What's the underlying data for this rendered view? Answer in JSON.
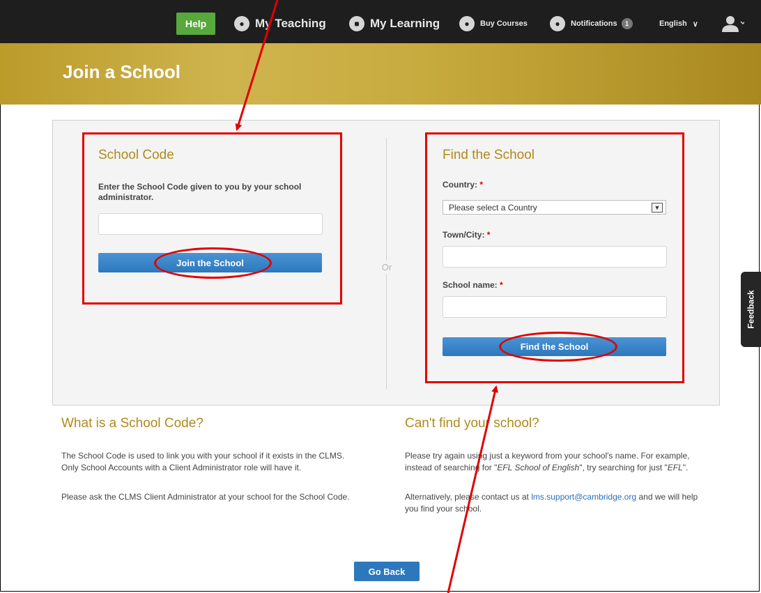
{
  "nav": {
    "help": "Help",
    "my_teaching": "My Teaching",
    "my_learning": "My Learning",
    "buy_courses": "Buy Courses",
    "notifications": "Notifications",
    "notifications_count": "1",
    "language": "English"
  },
  "page_title": "Join a School",
  "school_code": {
    "title": "School Code",
    "instruction": "Enter the School Code given to you by your school administrator.",
    "input_value": "",
    "button": "Join the School"
  },
  "separator": "Or",
  "find_school": {
    "title": "Find the School",
    "country_label": "Country:",
    "country_selected": "Please select a Country",
    "town_label": "Town/City:",
    "school_label": "School name:",
    "required_mark": "*",
    "button": "Find the School"
  },
  "info_left": {
    "heading": "What is a School Code?",
    "p1": "The School Code is used to link you with your school if it exists in the CLMS. Only School Accounts with a Client Administrator role will have it.",
    "p2": "Please ask the CLMS Client Administrator at your school for the School Code."
  },
  "info_right": {
    "heading": "Can't find your school?",
    "p1_a": "Please try again using just a keyword from your school's name. For example, instead of searching for \"",
    "p1_em1": "EFL School of English",
    "p1_b": "\", try searching for just \"",
    "p1_em2": "EFL",
    "p1_c": "\".",
    "p2_a": "Alternatively, please contact us at ",
    "p2_link": "lms.support@cambridge.org",
    "p2_b": " and we will help you find your school."
  },
  "go_back": "Go Back",
  "feedback": "Feedback",
  "colors": {
    "nav_bg": "#1e1e1e",
    "help_green": "#58a83c",
    "gold": "#c8ab3f",
    "heading_gold": "#b08a1a",
    "button_blue": "#2d78bd",
    "annotation_red": "#e00000"
  }
}
